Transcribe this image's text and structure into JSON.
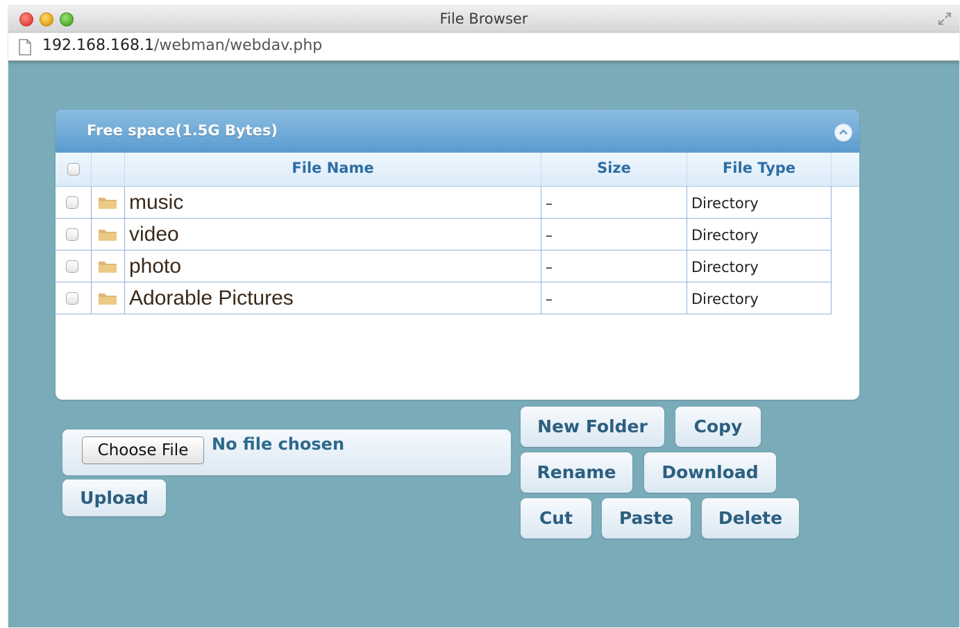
{
  "window": {
    "title": "File Browser"
  },
  "address": {
    "host": "192.168.168.1",
    "path": "/webman/webdav.php"
  },
  "panel": {
    "title": "Free space(1.5G Bytes)"
  },
  "table": {
    "columns": {
      "name": "File Name",
      "size": "Size",
      "type": "File Type"
    },
    "rows": [
      {
        "name": "music",
        "size": "–",
        "type": "Directory"
      },
      {
        "name": "video",
        "size": "–",
        "type": "Directory"
      },
      {
        "name": "photo",
        "size": "–",
        "type": "Directory"
      },
      {
        "name": "Adorable Pictures",
        "size": "–",
        "type": "Directory"
      }
    ]
  },
  "upload": {
    "choose_label": "Choose File",
    "status": "No file chosen",
    "upload_label": "Upload"
  },
  "actions": {
    "new_folder": "New Folder",
    "copy": "Copy",
    "rename": "Rename",
    "download": "Download",
    "cut": "Cut",
    "paste": "Paste",
    "delete": "Delete"
  },
  "colors": {
    "background": "#7aabb9",
    "header": "#5b9bd0",
    "accent_text": "#2e6da4"
  },
  "icons": {
    "folder": "folder-icon",
    "collapse": "collapse-icon",
    "page": "page-icon",
    "fullscreen": "fullscreen-icon"
  }
}
